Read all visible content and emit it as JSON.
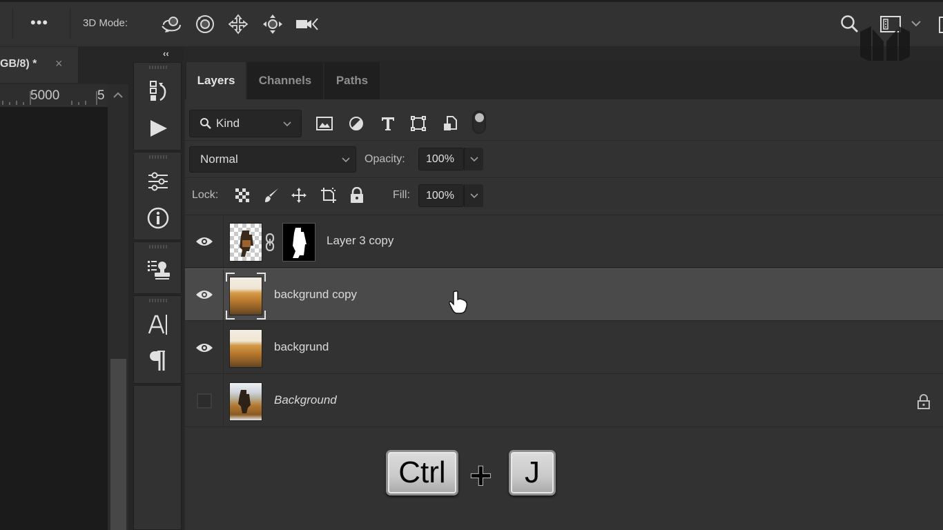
{
  "options_bar": {
    "more_label": "•••",
    "mode_label": "3D Mode:",
    "mode_tools": [
      "orbit-3d-icon",
      "roll-3d-icon",
      "drag-3d-icon",
      "slide-3d-icon",
      "scale-3d-camera-icon"
    ],
    "right_icons": [
      "search-icon",
      "workspace-switcher-icon",
      "chevron-down-icon"
    ]
  },
  "document": {
    "tab_title": "GB/8) *",
    "close_label": "×",
    "ruler": {
      "label_1": "5000",
      "label_2": "5"
    }
  },
  "panel_strip": {
    "collapse_label": "‹‹",
    "groups": [
      {
        "icons": [
          "history-icon",
          "actions-play-icon"
        ]
      },
      {
        "icons": [
          "adjustments-sliders-icon",
          "info-icon"
        ]
      },
      {
        "icons": [
          "clone-source-icon"
        ]
      },
      {
        "icons": [
          "character-icon",
          "paragraph-icon"
        ]
      }
    ]
  },
  "layers_panel": {
    "tabs": [
      {
        "label": "Layers",
        "active": true
      },
      {
        "label": "Channels",
        "active": false
      },
      {
        "label": "Paths",
        "active": false
      }
    ],
    "filter": {
      "kind_label": "Kind",
      "filter_icons": [
        "pixel-filter-icon",
        "adjustment-filter-icon",
        "type-filter-icon",
        "shape-filter-icon",
        "smart-object-filter-icon"
      ],
      "toggle_on": false
    },
    "blend_mode": "Normal",
    "opacity_label": "Opacity:",
    "opacity_value": "100%",
    "lock_label": "Lock:",
    "lock_icons": [
      "lock-transparent-pixels-icon",
      "lock-image-pixels-icon",
      "lock-position-icon",
      "lock-artboard-icon",
      "lock-all-icon"
    ],
    "fill_label": "Fill:",
    "fill_value": "100%",
    "layers": [
      {
        "name": "Layer 3 copy",
        "visible": true,
        "selected": false,
        "has_mask": true,
        "locked": false,
        "italic": false
      },
      {
        "name": "backgrund copy",
        "visible": true,
        "selected": true,
        "has_mask": false,
        "locked": false,
        "italic": false
      },
      {
        "name": "backgrund",
        "visible": true,
        "selected": false,
        "has_mask": false,
        "locked": false,
        "italic": false
      },
      {
        "name": "Background",
        "visible": false,
        "selected": false,
        "has_mask": false,
        "locked": true,
        "italic": true
      }
    ]
  },
  "shortcut_overlay": {
    "key_1": "Ctrl",
    "plus": "+",
    "key_2": "J"
  }
}
